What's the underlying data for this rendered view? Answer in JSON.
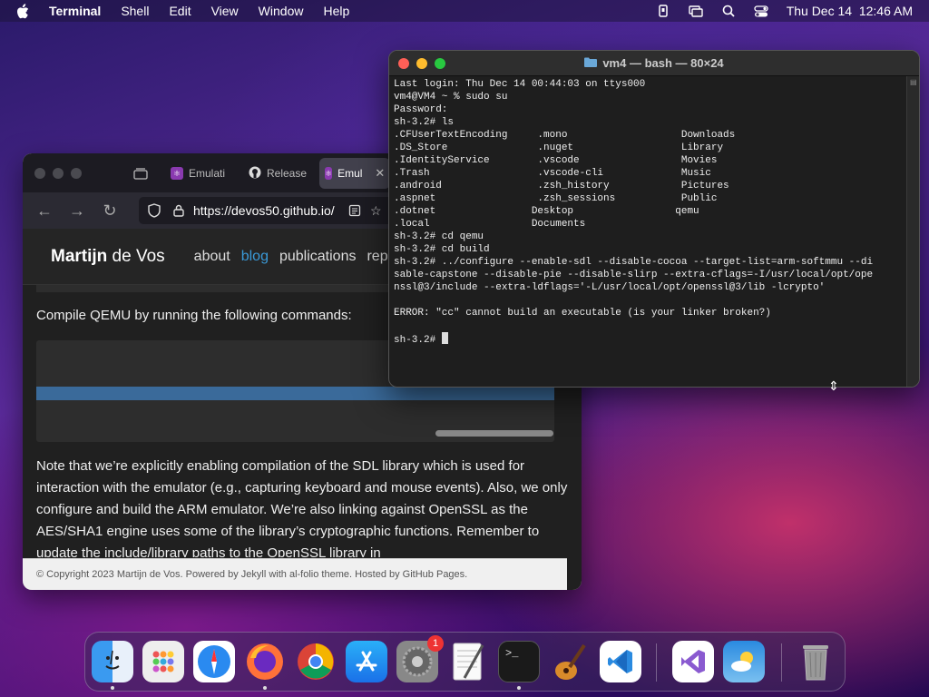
{
  "menubar": {
    "app_name": "Terminal",
    "items": [
      "Shell",
      "Edit",
      "View",
      "Window",
      "Help"
    ],
    "clock": "Thu Dec 14  12:46 AM"
  },
  "browser": {
    "tabs": [
      {
        "label": "Emulati"
      },
      {
        "label": "Release"
      },
      {
        "label": "Emul"
      }
    ],
    "url": "https://devos50.github.io/",
    "site": {
      "brand_first": "Martijn",
      "brand_rest": " de Vos",
      "nav": [
        "about",
        "blog",
        "publications",
        "rep"
      ]
    },
    "intro": "Compile QEMU by running the following commands:",
    "paragraph": "Note that we’re explicitly enabling compilation of the SDL library which is used for interaction with the emulator (e.g., capturing keyboard and mouse events). Also, we only configure and build the ARM emulator. We’re also linking against OpenSSL as the AES/SHA1 engine uses some of the library’s cryptographic functions. Remember to update the include/library paths to the OpenSSL library in",
    "footer": "© Copyright 2023 Martijn de Vos. Powered by Jekyll with al-folio theme. Hosted by GitHub Pages."
  },
  "terminal": {
    "title": "vm4 — bash — 80×24",
    "lines": [
      "Last login: Thu Dec 14 00:44:03 on ttys000",
      "vm4@VM4 ~ % sudo su",
      "Password:",
      "sh-3.2# ls",
      ".CFUserTextEncoding     .mono                   Downloads",
      ".DS_Store               .nuget                  Library",
      ".IdentityService        .vscode                 Movies",
      ".Trash                  .vscode-cli             Music",
      ".android                .zsh_history            Pictures",
      ".aspnet                 .zsh_sessions           Public",
      ".dotnet                Desktop                 qemu",
      ".local                 Documents",
      "sh-3.2# cd qemu",
      "sh-3.2# cd build",
      "sh-3.2# ../configure --enable-sdl --disable-cocoa --target-list=arm-softmmu --di",
      "sable-capstone --disable-pie --disable-slirp --extra-cflags=-I/usr/local/opt/ope",
      "nssl@3/include --extra-ldflags='-L/usr/local/opt/openssl@3/lib -lcrypto'",
      "",
      "ERROR: \"cc\" cannot build an executable (is your linker broken?)",
      "",
      "sh-3.2# "
    ]
  },
  "dock": {
    "items": [
      {
        "icon": "finder-icon",
        "running": true
      },
      {
        "icon": "launchpad-icon",
        "running": false
      },
      {
        "icon": "safari-icon",
        "running": false
      },
      {
        "icon": "firefox-icon",
        "running": true
      },
      {
        "icon": "chrome-icon",
        "running": false
      },
      {
        "icon": "app-store-icon",
        "running": false
      },
      {
        "icon": "system-settings-icon",
        "running": false,
        "badge": "1"
      },
      {
        "icon": "textedit-icon",
        "running": false
      },
      {
        "icon": "terminal-icon",
        "running": true
      },
      {
        "icon": "garageband-icon",
        "running": false
      },
      {
        "icon": "vscode-icon",
        "running": false
      },
      {
        "icon": "visual-studio-icon",
        "running": false
      },
      {
        "icon": "weather-icon",
        "running": false
      },
      {
        "icon": "trash-icon",
        "running": false
      }
    ]
  },
  "colors": {
    "accent": "#3a9ad9",
    "term_bg": "#1e1e1e"
  }
}
